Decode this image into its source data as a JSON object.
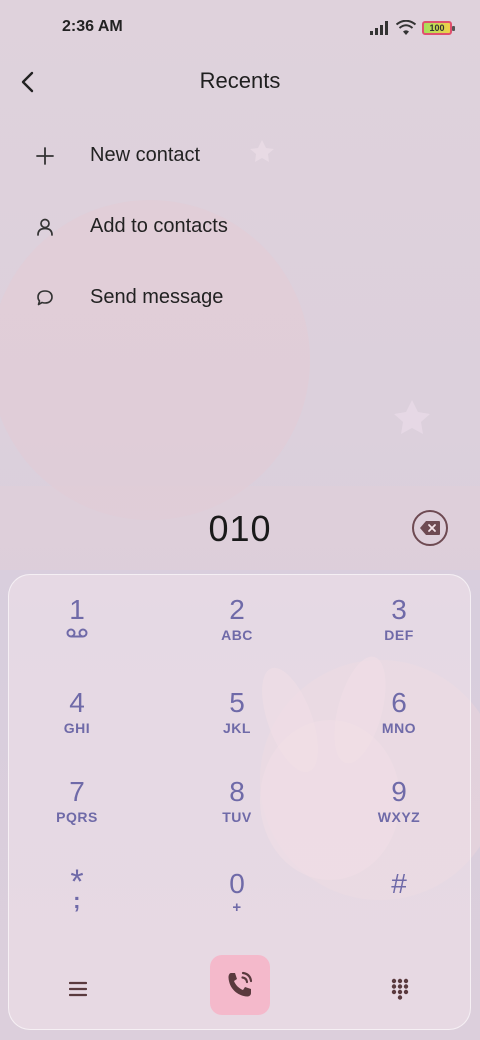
{
  "status_bar": {
    "time": "2:36 AM",
    "battery": "100",
    "icons": [
      "signal-icon",
      "wifi-icon",
      "battery-icon"
    ]
  },
  "header": {
    "title": "Recents",
    "back_icon": "chevron-left-icon"
  },
  "options": [
    {
      "icon": "plus-icon",
      "label": "New contact"
    },
    {
      "icon": "person-icon",
      "label": "Add to contacts"
    },
    {
      "icon": "chat-bubble-icon",
      "label": "Send message"
    }
  ],
  "dialed_number": "010",
  "keypad": {
    "keys": [
      {
        "digit": "1",
        "letters": ""
      },
      {
        "digit": "2",
        "letters": "ABC"
      },
      {
        "digit": "3",
        "letters": "DEF"
      },
      {
        "digit": "4",
        "letters": "GHI"
      },
      {
        "digit": "5",
        "letters": "JKL"
      },
      {
        "digit": "6",
        "letters": "MNO"
      },
      {
        "digit": "7",
        "letters": "PQRS"
      },
      {
        "digit": "8",
        "letters": "TUV"
      },
      {
        "digit": "9",
        "letters": "WXYZ"
      },
      {
        "digit": "*",
        "letters": ";"
      },
      {
        "digit": "0",
        "letters": "+"
      },
      {
        "digit": "#",
        "letters": ""
      }
    ]
  },
  "colors": {
    "key_text": "#6f6aa8",
    "call_button": "#f4b9cb",
    "call_icon": "#5a3a3e"
  }
}
